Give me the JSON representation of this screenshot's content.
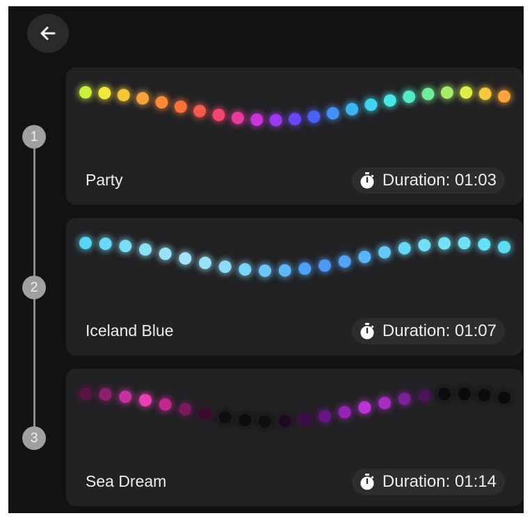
{
  "header": {
    "back_icon": "arrow-left-icon"
  },
  "programs": [
    {
      "step": "1",
      "name": "Party",
      "duration_label": "Duration: 01:03",
      "colors": [
        "#c8f03c",
        "#f2e83a",
        "#f6c43a",
        "#f7a33c",
        "#f88a38",
        "#f67238",
        "#f45b4a",
        "#f1476e",
        "#e63a9c",
        "#c936d8",
        "#9d3aee",
        "#6a46f2",
        "#4a62f4",
        "#4290f4",
        "#3cb6f2",
        "#40d4f0",
        "#46e6e6",
        "#50ecc4",
        "#72ec96",
        "#a6ec6a",
        "#dcee48",
        "#f7c83c",
        "#f8a43a"
      ]
    },
    {
      "step": "2",
      "name": "Iceland Blue",
      "duration_label": "Duration: 01:07",
      "colors": [
        "#58d4f4",
        "#6ad8f6",
        "#7cdcf6",
        "#8ce0f6",
        "#9ae2f8",
        "#a4e4f8",
        "#9ae0f8",
        "#8cdcf8",
        "#7ad4f8",
        "#6ac6f8",
        "#5cb6f8",
        "#4ea2f6",
        "#4e98f4",
        "#52a2f6",
        "#5ab4f6",
        "#62c8f6",
        "#6ad6f6",
        "#70def6",
        "#72e2f6",
        "#6ee2f4",
        "#66e0f4",
        "#5edcf4"
      ]
    },
    {
      "step": "3",
      "name": "Sea Dream",
      "duration_label": "Duration: 01:14",
      "colors": [
        "#5a1444",
        "#8c2070",
        "#c4309c",
        "#ea40b4",
        "#c02890",
        "#7a1860",
        "#3a0a2c",
        "#0e0e10",
        "#0c0c0e",
        "#0e0e10",
        "#1c0a20",
        "#3c0c48",
        "#6a1684",
        "#9624b4",
        "#bc34d8",
        "#a42ec0",
        "#7a2294",
        "#481658",
        "#0c0c0e",
        "#0a0a0c",
        "#0c0c0e",
        "#0a0a0c"
      ]
    }
  ]
}
